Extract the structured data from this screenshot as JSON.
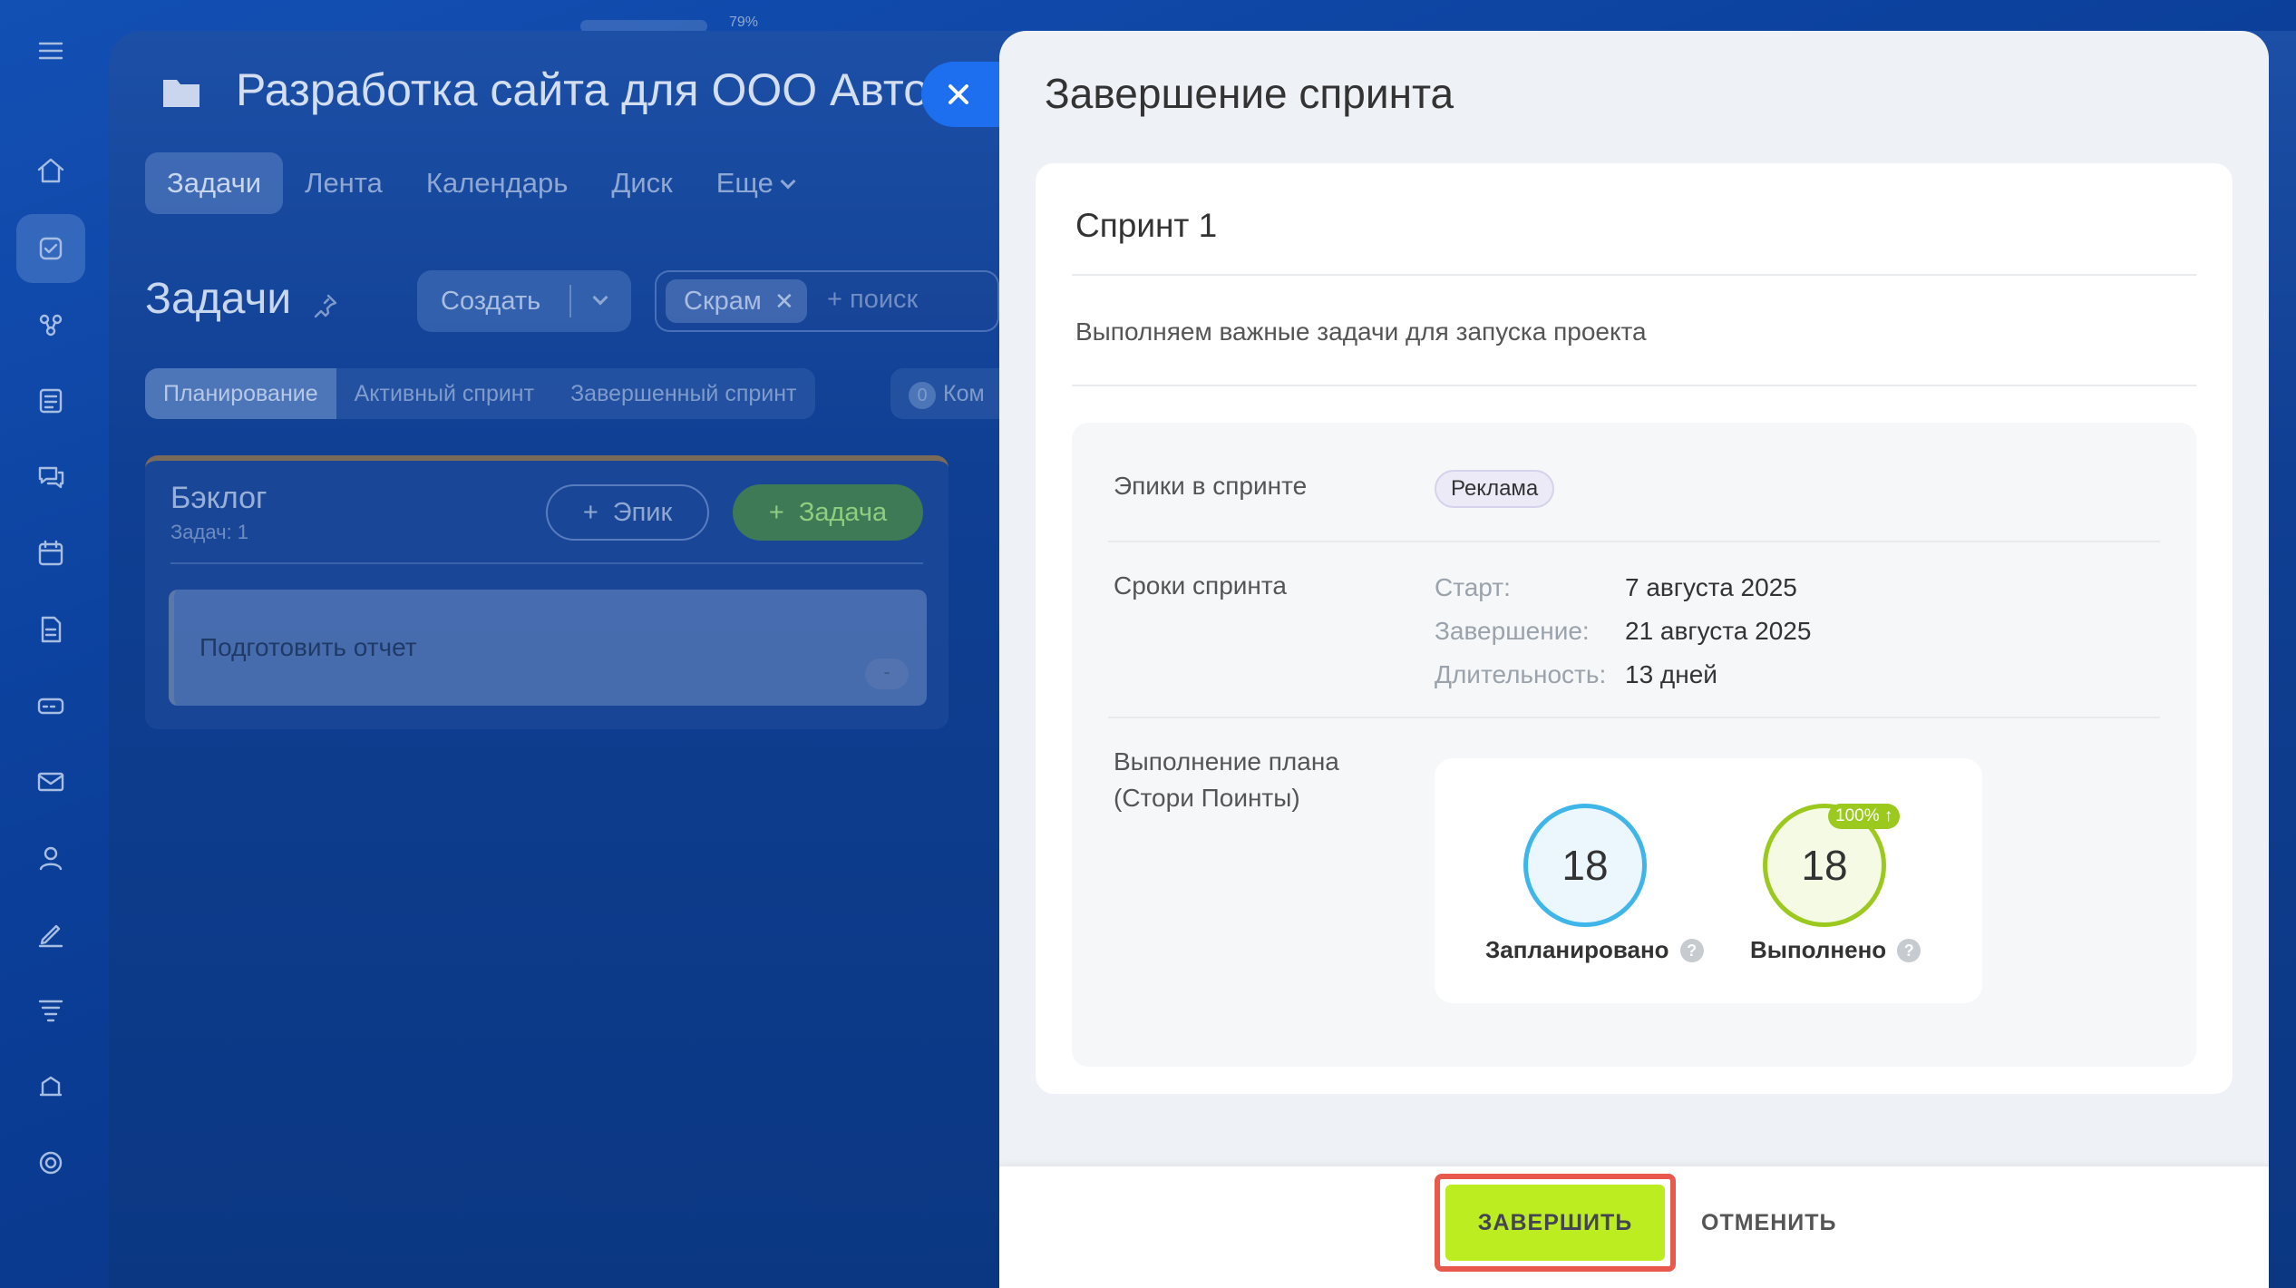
{
  "app": {
    "zoom_label": "79%",
    "project_title": "Разработка сайта для ООО Авто",
    "tabs": [
      {
        "label": "Задачи"
      },
      {
        "label": "Лента"
      },
      {
        "label": "Календарь"
      },
      {
        "label": "Диск"
      },
      {
        "label": "Еще"
      }
    ],
    "page_heading": "Задачи",
    "create_label": "Создать",
    "filter_chip": "Скрам",
    "search_placeholder": "+ поиск",
    "segments": [
      "Планирование",
      "Активный спринт",
      "Завершенный спринт"
    ],
    "extra_segment": {
      "count": "0",
      "label": "Ком"
    },
    "backlog": {
      "title": "Бэклог",
      "count": "Задач: 1",
      "epic_button": "Эпик",
      "task_button": "Задача",
      "items": [
        {
          "title": "Подготовить отчет",
          "points": "-"
        }
      ]
    }
  },
  "panel": {
    "title": "Завершение спринта",
    "sprint_name": "Спринт 1",
    "sprint_description": "Выполняем важные задачи для запуска проекта",
    "epics_label": "Эпики в спринте",
    "epic_tag": "Реклама",
    "dates_label": "Сроки спринта",
    "dates": [
      {
        "key": "Старт:",
        "value": "7 августа 2025"
      },
      {
        "key": "Завершение:",
        "value": "21 августа 2025"
      },
      {
        "key": "Длительность:",
        "value": "13 дней"
      }
    ],
    "plan_label_line1": "Выполнение плана",
    "plan_label_line2": "(Стори Поинты)",
    "planned_value": "18",
    "planned_label": "Запланировано",
    "done_value": "18",
    "done_label": "Выполнено",
    "done_percent": "100% ↑",
    "finish_button": "ЗАВЕРШИТЬ",
    "cancel_button": "ОТМЕНИТЬ"
  },
  "colors": {
    "finish_button": "#bbed21",
    "planned_ring": "#3fb6ea",
    "done_ring": "#9bc91e",
    "highlight_outline": "#e9584c",
    "close_button": "#1e6ff0"
  }
}
